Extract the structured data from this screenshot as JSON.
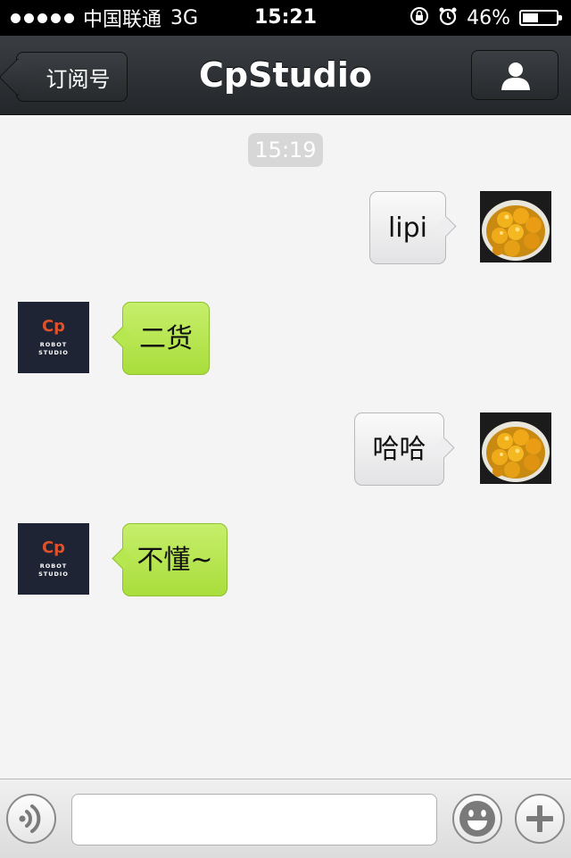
{
  "status_bar": {
    "carrier": "中国联通",
    "network": "3G",
    "time": "15:21",
    "battery_percent": "46%",
    "battery_level": 0.46,
    "icons": [
      "signal-dots-icon",
      "rotation-lock-icon",
      "alarm-icon",
      "battery-icon"
    ]
  },
  "nav": {
    "back_label": "订阅号",
    "title": "CpStudio",
    "profile_icon": "user-icon"
  },
  "chat": {
    "timestamp": "15:19",
    "messages": [
      {
        "side": "right",
        "text": "lipi",
        "avatar": "food-photo"
      },
      {
        "side": "left",
        "text": "二货",
        "avatar": "cp-robot-studio-logo"
      },
      {
        "side": "right",
        "text": "哈哈",
        "avatar": "food-photo"
      },
      {
        "side": "left",
        "text": "不懂~",
        "avatar": "cp-robot-studio-logo"
      }
    ],
    "logo_text": {
      "mark": "Cp",
      "line1": "ROBOT",
      "line2": "STUDIO"
    }
  },
  "input_bar": {
    "text_value": "",
    "placeholder": "",
    "icons": [
      "voice-icon",
      "emoji-icon",
      "plus-icon"
    ]
  },
  "colors": {
    "nav_bg": "#2b2f33",
    "bubble_mine": "#eeeef0",
    "bubble_theirs": "#b6e650",
    "logo_accent": "#e0502a",
    "logo_bg": "#1e2433"
  }
}
